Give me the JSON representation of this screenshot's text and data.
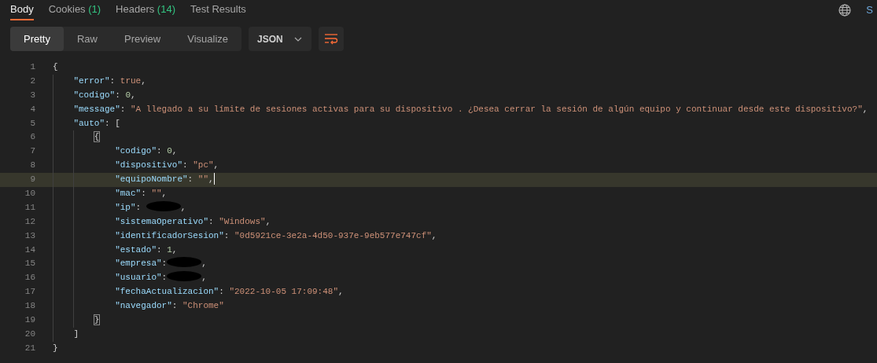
{
  "response_tabs": [
    {
      "label": "Body",
      "selected": true
    },
    {
      "label": "Cookies",
      "count": "(1)",
      "selected": false
    },
    {
      "label": "Headers",
      "count": "(14)",
      "selected": false
    },
    {
      "label": "Test Results",
      "selected": false
    }
  ],
  "right_edge_text": "S",
  "view_modes": [
    {
      "label": "Pretty",
      "selected": true
    },
    {
      "label": "Raw",
      "selected": false
    },
    {
      "label": "Preview",
      "selected": false
    },
    {
      "label": "Visualize",
      "selected": false
    }
  ],
  "format_dropdown": {
    "value": "JSON"
  },
  "code_lines": [
    {
      "number": "1",
      "highlighted": false,
      "tokens": [
        {
          "kind": "punct",
          "text": "{"
        }
      ],
      "children": [
        {
          "number": "2",
          "highlighted": false,
          "tokens": [
            {
              "kind": "key",
              "text": "\"error\""
            },
            {
              "kind": "punct",
              "text": ": "
            },
            {
              "kind": "boolean",
              "text": "true"
            },
            {
              "kind": "punct",
              "text": ","
            }
          ]
        },
        {
          "number": "3",
          "highlighted": false,
          "tokens": [
            {
              "kind": "key",
              "text": "\"codigo\""
            },
            {
              "kind": "punct",
              "text": ": "
            },
            {
              "kind": "number",
              "text": "0"
            },
            {
              "kind": "punct",
              "text": ","
            }
          ]
        },
        {
          "number": "4",
          "highlighted": false,
          "tokens": [
            {
              "kind": "key",
              "text": "\"message\""
            },
            {
              "kind": "punct",
              "text": ": "
            },
            {
              "kind": "string",
              "text": "\"A llegado a su límite de sesiones activas para su dispositivo . ¿Desea cerrar la sesión de algún equipo y continuar desde este dispositivo?\""
            },
            {
              "kind": "punct",
              "text": ","
            }
          ]
        },
        {
          "number": "5",
          "highlighted": false,
          "tokens": [
            {
              "kind": "key",
              "text": "\"auto\""
            },
            {
              "kind": "punct",
              "text": ": ["
            }
          ],
          "children": [
            {
              "number": "6",
              "highlighted": false,
              "tokens": [
                {
                  "kind": "bracket_match",
                  "text": "{"
                }
              ],
              "children": [
                {
                  "number": "7",
                  "highlighted": false,
                  "tokens": [
                    {
                      "kind": "key",
                      "text": "\"codigo\""
                    },
                    {
                      "kind": "punct",
                      "text": ": "
                    },
                    {
                      "kind": "number",
                      "text": "0"
                    },
                    {
                      "kind": "punct",
                      "text": ","
                    }
                  ]
                },
                {
                  "number": "8",
                  "highlighted": false,
                  "tokens": [
                    {
                      "kind": "key",
                      "text": "\"dispositivo\""
                    },
                    {
                      "kind": "punct",
                      "text": ": "
                    },
                    {
                      "kind": "string",
                      "text": "\"pc\""
                    },
                    {
                      "kind": "punct",
                      "text": ","
                    }
                  ]
                },
                {
                  "number": "9",
                  "highlighted": true,
                  "tokens": [
                    {
                      "kind": "key",
                      "text": "\"equipoNombre\""
                    },
                    {
                      "kind": "punct",
                      "text": ": "
                    },
                    {
                      "kind": "string",
                      "text": "\"\""
                    },
                    {
                      "kind": "punct",
                      "text": ","
                    }
                  ]
                },
                {
                  "number": "10",
                  "highlighted": false,
                  "tokens": [
                    {
                      "kind": "key",
                      "text": "\"mac\""
                    },
                    {
                      "kind": "punct",
                      "text": ": "
                    },
                    {
                      "kind": "string",
                      "text": "\"\""
                    },
                    {
                      "kind": "punct",
                      "text": ","
                    }
                  ]
                },
                {
                  "number": "11",
                  "highlighted": false,
                  "tokens": [
                    {
                      "kind": "key",
                      "text": "\"ip\""
                    },
                    {
                      "kind": "punct",
                      "text": ": "
                    },
                    {
                      "kind": "redacted"
                    },
                    {
                      "kind": "punct",
                      "text": ","
                    }
                  ]
                },
                {
                  "number": "12",
                  "highlighted": false,
                  "tokens": [
                    {
                      "kind": "key",
                      "text": "\"sistemaOperativo\""
                    },
                    {
                      "kind": "punct",
                      "text": ": "
                    },
                    {
                      "kind": "string",
                      "text": "\"Windows\""
                    },
                    {
                      "kind": "punct",
                      "text": ","
                    }
                  ]
                },
                {
                  "number": "13",
                  "highlighted": false,
                  "tokens": [
                    {
                      "kind": "key",
                      "text": "\"identificadorSesion\""
                    },
                    {
                      "kind": "punct",
                      "text": ": "
                    },
                    {
                      "kind": "string",
                      "text": "\"0d5921ce-3e2a-4d50-937e-9eb577e747cf\""
                    },
                    {
                      "kind": "punct",
                      "text": ","
                    }
                  ]
                },
                {
                  "number": "14",
                  "highlighted": false,
                  "tokens": [
                    {
                      "kind": "key",
                      "text": "\"estado\""
                    },
                    {
                      "kind": "punct",
                      "text": ": "
                    },
                    {
                      "kind": "number",
                      "text": "1"
                    },
                    {
                      "kind": "punct",
                      "text": ","
                    }
                  ]
                },
                {
                  "number": "15",
                  "highlighted": false,
                  "tokens": [
                    {
                      "kind": "key",
                      "text": "\"empresa\""
                    },
                    {
                      "kind": "punct",
                      "text": ":"
                    },
                    {
                      "kind": "redacted"
                    },
                    {
                      "kind": "punct",
                      "text": ","
                    }
                  ]
                },
                {
                  "number": "16",
                  "highlighted": false,
                  "tokens": [
                    {
                      "kind": "key",
                      "text": "\"usuario\""
                    },
                    {
                      "kind": "punct",
                      "text": ":"
                    },
                    {
                      "kind": "redacted"
                    },
                    {
                      "kind": "punct",
                      "text": ","
                    }
                  ]
                },
                {
                  "number": "17",
                  "highlighted": false,
                  "tokens": [
                    {
                      "kind": "key",
                      "text": "\"fechaActualizacion\""
                    },
                    {
                      "kind": "punct",
                      "text": ": "
                    },
                    {
                      "kind": "string",
                      "text": "\"2022-10-05 17:09:48\""
                    },
                    {
                      "kind": "punct",
                      "text": ","
                    }
                  ]
                },
                {
                  "number": "18",
                  "highlighted": false,
                  "tokens": [
                    {
                      "kind": "key",
                      "text": "\"navegador\""
                    },
                    {
                      "kind": "punct",
                      "text": ": "
                    },
                    {
                      "kind": "string",
                      "text": "\"Chrome\""
                    }
                  ]
                }
              ]
            },
            {
              "number": "19",
              "highlighted": false,
              "tokens": [
                {
                  "kind": "bracket_match",
                  "text": "}"
                }
              ]
            }
          ]
        },
        {
          "number": "20",
          "highlighted": false,
          "tokens": [
            {
              "kind": "punct",
              "text": "]"
            }
          ]
        }
      ]
    },
    {
      "number": "21",
      "highlighted": false,
      "tokens": [
        {
          "kind": "punct",
          "text": "}"
        }
      ]
    }
  ]
}
